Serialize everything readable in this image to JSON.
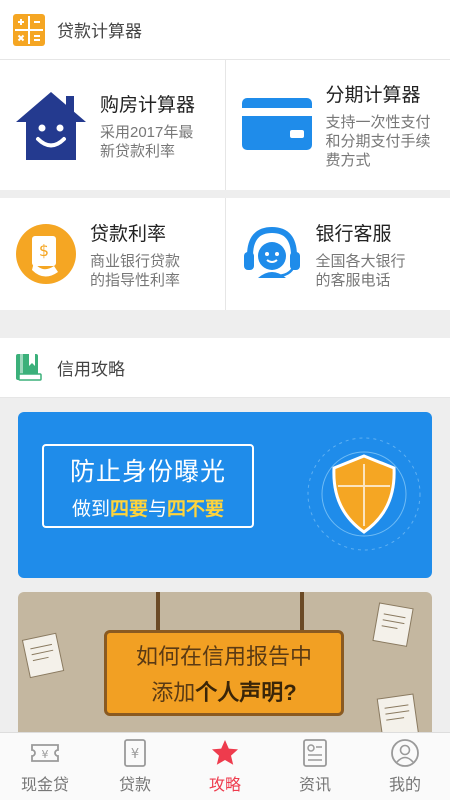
{
  "loan_calc": {
    "title": "贷款计算器",
    "items": [
      {
        "title": "购房计算器",
        "desc1": "采用2017年最",
        "desc2": "新贷款利率",
        "icon": "house-smile-icon"
      },
      {
        "title": "分期计算器",
        "desc1": "支持一次性支付",
        "desc2": "和分期支付手续",
        "desc3": "费方式",
        "icon": "card-icon"
      },
      {
        "title": "贷款利率",
        "desc1": "商业银行贷款",
        "desc2": "的指导性利率",
        "icon": "money-hand-icon"
      },
      {
        "title": "银行客服",
        "desc1": "全国各大银行",
        "desc2": "的客服电话",
        "icon": "headset-icon"
      }
    ]
  },
  "credit_guide": {
    "title": "信用攻略",
    "banner1": {
      "line1": "防止身份曝光",
      "prefix": "做到",
      "hl1": "四要",
      "mid": "与",
      "hl2": "四不要"
    },
    "banner2": {
      "line1": "如何在信用报告中",
      "prefix": "添加",
      "strong": "个人声明?"
    }
  },
  "tabs": [
    {
      "label": "现金贷",
      "icon": "ticket-icon",
      "active": false
    },
    {
      "label": "贷款",
      "icon": "yen-doc-icon",
      "active": false
    },
    {
      "label": "攻略",
      "icon": "star-icon",
      "active": true
    },
    {
      "label": "资讯",
      "icon": "news-icon",
      "active": false
    },
    {
      "label": "我的",
      "icon": "user-icon",
      "active": false
    }
  ],
  "colors": {
    "accent": "#ee3b4d",
    "calc_icon": "#f5a623",
    "blue": "#1f8cea",
    "navy": "#243a8f",
    "green": "#3bb07a"
  }
}
